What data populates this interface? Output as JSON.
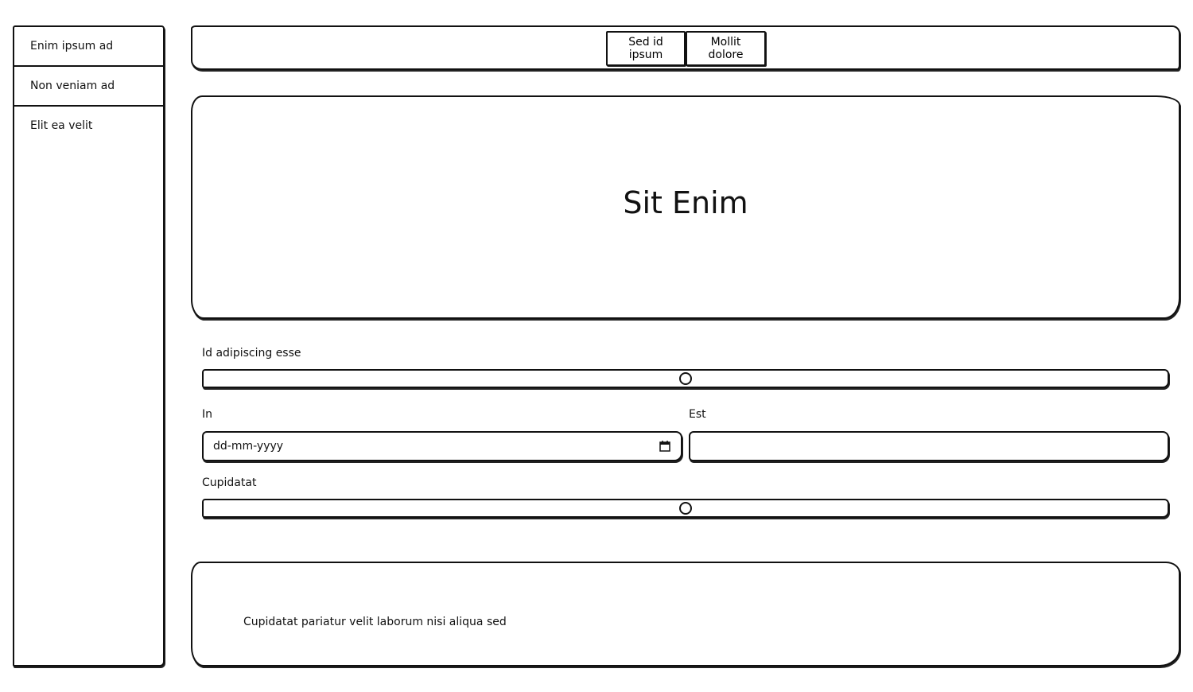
{
  "sidebar": {
    "items": [
      {
        "label": "Enim ipsum ad"
      },
      {
        "label": "Non veniam ad"
      },
      {
        "label": "Elit ea velit"
      }
    ]
  },
  "topbar": {
    "buttons": [
      {
        "label": "Sed id ipsum"
      },
      {
        "label": "Mollit dolore"
      }
    ]
  },
  "hero": {
    "title": "Sit Enim"
  },
  "form": {
    "slider1": {
      "label": "Id adipiscing esse",
      "value_fraction": 0.5
    },
    "date_field": {
      "label": "In",
      "placeholder": "dd-mm-yyyy",
      "icon": "calendar-icon"
    },
    "text_field": {
      "label": "Est",
      "value": ""
    },
    "slider2": {
      "label": "Cupidatat",
      "value_fraction": 0.5
    }
  },
  "footer_card": {
    "text": "Cupidatat pariatur velit laborum nisi aliqua sed"
  }
}
